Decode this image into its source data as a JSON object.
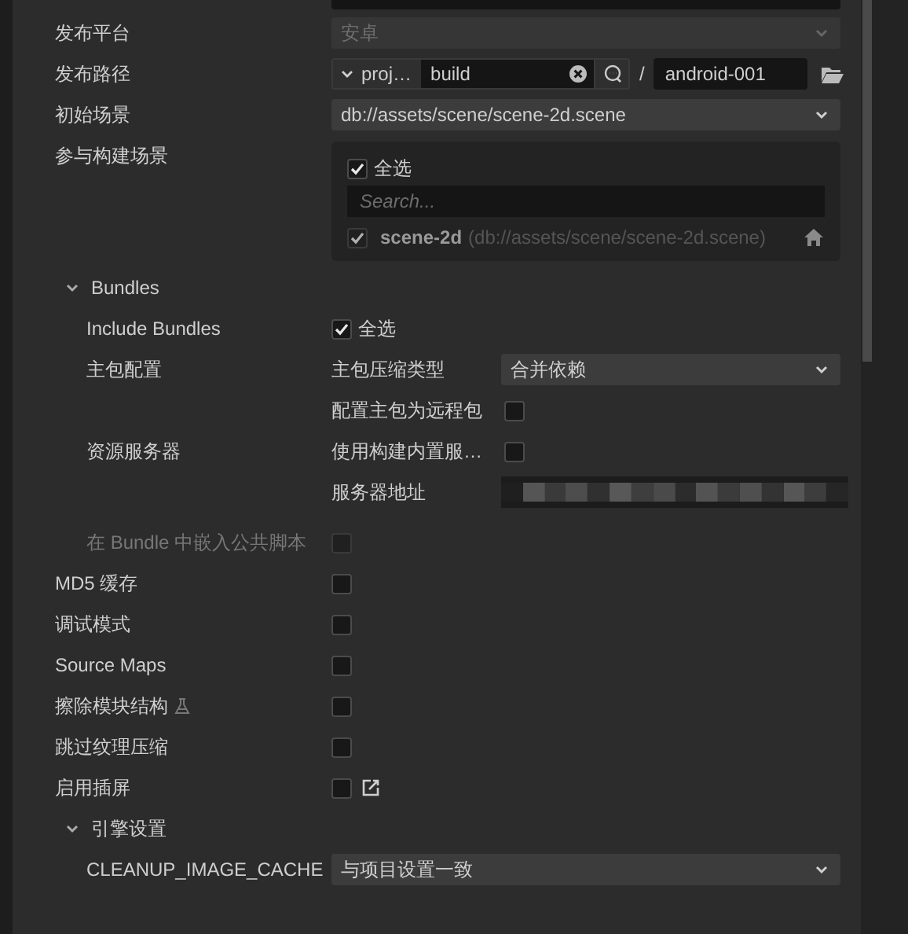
{
  "settings": [
    {
      "kind": "select",
      "label": "发布平台",
      "value": "安卓",
      "disabled": true
    },
    {
      "kind": "path",
      "label": "发布路径",
      "prefix": "proj…",
      "value": "build",
      "separator": "/",
      "folder": "android-001"
    },
    {
      "kind": "select",
      "label": "初始场景",
      "value": "db://assets/scene/scene-2d.scene",
      "disabled": false
    },
    {
      "kind": "scenes",
      "label": "参与构建场景",
      "select_all": {
        "label": "全选",
        "checked": true
      },
      "search": {
        "placeholder": "Search..."
      },
      "scenes": [
        {
          "name": "scene-2d",
          "path": "(db://assets/scene/scene-2d.scene)",
          "checked": true,
          "disabled": true
        }
      ]
    },
    {
      "kind": "section",
      "label": "Bundles",
      "expanded": true,
      "children": [
        {
          "kind": "checkbox",
          "label": "Include Bundles",
          "checked": true,
          "text": "全选",
          "disabled": false
        },
        {
          "kind": "group",
          "label": "主包配置",
          "items": [
            {
              "kind": "select",
              "label": "主包压缩类型",
              "value": "合并依赖",
              "disabled": false
            },
            {
              "kind": "checkbox",
              "label": "配置主包为远程包",
              "checked": false,
              "disabled": false
            }
          ]
        },
        {
          "kind": "group",
          "label": "资源服务器",
          "items": [
            {
              "kind": "checkbox",
              "label": "使用构建内置服…",
              "checked": false,
              "disabled": false
            },
            {
              "kind": "hidden",
              "label": "服务器地址"
            }
          ]
        },
        {
          "kind": "checkbox",
          "label": "在 Bundle 中嵌入公共脚本",
          "checked": false,
          "disabled": true
        }
      ]
    },
    {
      "kind": "checkbox",
      "label": "MD5 缓存",
      "checked": false,
      "disabled": false
    },
    {
      "kind": "checkbox",
      "label": "调试模式",
      "checked": false,
      "disabled": false
    },
    {
      "kind": "checkbox",
      "label": "Source Maps",
      "checked": false,
      "disabled": false
    },
    {
      "kind": "checkbox",
      "label": "擦除模块结构",
      "checked": false,
      "disabled": false,
      "experimental": true
    },
    {
      "kind": "checkbox",
      "label": "跳过纹理压缩",
      "checked": false,
      "disabled": false
    },
    {
      "kind": "checkbox",
      "label": "启用插屏",
      "checked": false,
      "disabled": false,
      "editable": true
    },
    {
      "kind": "section",
      "label": "引擎设置",
      "expanded": true,
      "children": [
        {
          "kind": "select",
          "label": "CLEANUP_IMAGE_CACHE",
          "value": "与项目设置一致",
          "disabled": false
        }
      ]
    }
  ]
}
